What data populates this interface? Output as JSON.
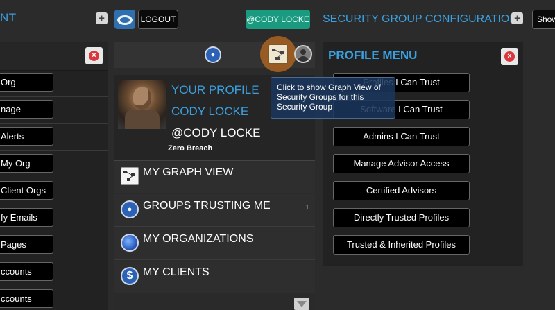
{
  "left_panel": {
    "title": "NT",
    "items": [
      "Org",
      "nage",
      "Alerts",
      "My Org",
      "Client Orgs",
      "fy Emails",
      "Pages",
      "ccounts",
      "ccounts"
    ]
  },
  "header": {
    "logout_label": "LOGOUT",
    "user_badge": "@CODY LOCKE"
  },
  "profile": {
    "your_profile_label": "YOUR PROFILE",
    "name": "CODY LOCKE",
    "handle": "@CODY LOCKE",
    "tag": "Zero Breach"
  },
  "menu": [
    {
      "label": "MY GRAPH VIEW",
      "icon": "graph-view-icon"
    },
    {
      "label": "GROUPS TRUSTING ME",
      "icon": "groups-icon",
      "count": "1"
    },
    {
      "label": "MY ORGANIZATIONS",
      "icon": "globe-icon"
    },
    {
      "label": "MY CLIENTS",
      "icon": "dollar-icon"
    }
  ],
  "tooltip": "Click to show Graph View of Security Groups for this Security Group",
  "security_config": {
    "title": "SECURITY GROUP CONFIGURATION",
    "menu_title": "PROFILE MENU",
    "items": [
      "Profiles I Can Trust",
      "Software I Can Trust",
      "Admins I Can Trust",
      "Manage Advisor Access",
      "Certified Advisors",
      "Directly Trusted Profiles",
      "Trusted & Inherited Profiles"
    ]
  },
  "show_label": "Show",
  "colors": {
    "accent": "#3aa0e0",
    "user_badge_bg": "#1a9a7f",
    "close": "#d9363e",
    "highlight_ring": "#a35f22"
  }
}
